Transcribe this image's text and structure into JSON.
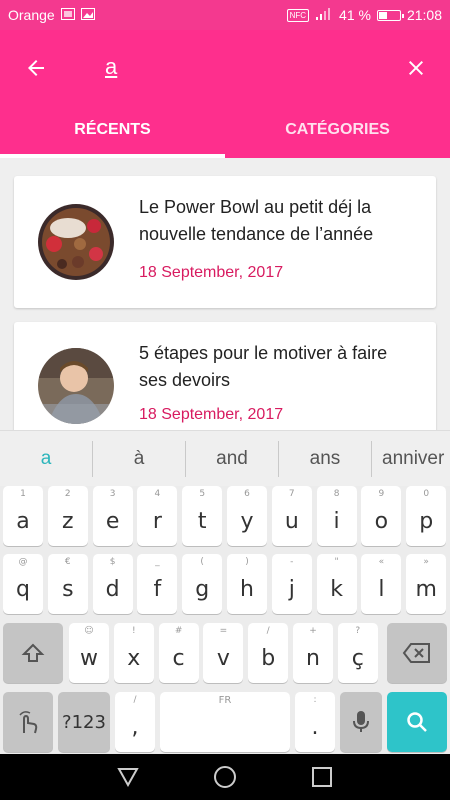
{
  "status_bar": {
    "carrier": "Orange",
    "nfc": "NFC",
    "battery_percent": "41 %",
    "battery_level": 0.41,
    "time": "21:08"
  },
  "app_bar": {
    "back_icon": "arrow-left-icon",
    "search_value": "a",
    "close_icon": "close-icon",
    "tabs": [
      {
        "label": "RÉCENTS",
        "active": true
      },
      {
        "label": "CATÉGORIES",
        "active": false
      }
    ]
  },
  "articles": [
    {
      "title": "Le Power Bowl au petit déj la nouvelle tendance de l’année",
      "date": "18 September, 2017"
    },
    {
      "title": "5 étapes pour le motiver à faire ses devoirs",
      "date": "18 September, 2017"
    }
  ],
  "keyboard": {
    "suggestions": [
      "a",
      "à",
      "and",
      "ans",
      "anniver"
    ],
    "row1": [
      {
        "main": "a",
        "alt": "1"
      },
      {
        "main": "z",
        "alt": "2"
      },
      {
        "main": "e",
        "alt": "3"
      },
      {
        "main": "r",
        "alt": "4"
      },
      {
        "main": "t",
        "alt": "5"
      },
      {
        "main": "y",
        "alt": "6"
      },
      {
        "main": "u",
        "alt": "7"
      },
      {
        "main": "i",
        "alt": "8"
      },
      {
        "main": "o",
        "alt": "9"
      },
      {
        "main": "p",
        "alt": "0"
      }
    ],
    "row2": [
      {
        "main": "q",
        "alt": "@"
      },
      {
        "main": "s",
        "alt": "€"
      },
      {
        "main": "d",
        "alt": "$"
      },
      {
        "main": "f",
        "alt": "_"
      },
      {
        "main": "g",
        "alt": "("
      },
      {
        "main": "h",
        "alt": ")"
      },
      {
        "main": "j",
        "alt": "-"
      },
      {
        "main": "k",
        "alt": "\""
      },
      {
        "main": "l",
        "alt": "«"
      },
      {
        "main": "m",
        "alt": "»"
      }
    ],
    "row3": [
      {
        "main": "w",
        "alt": "☺"
      },
      {
        "main": "x",
        "alt": "!"
      },
      {
        "main": "c",
        "alt": "#"
      },
      {
        "main": "v",
        "alt": "="
      },
      {
        "main": "b",
        "alt": "/"
      },
      {
        "main": "n",
        "alt": "+"
      },
      {
        "main": "ç",
        "alt": "?"
      }
    ],
    "symbols_label": "?123",
    "comma": ",",
    "comma_alt": "/",
    "space_label": "FR",
    "period": ".",
    "period_alt": ":",
    "shift_icon": "shift-icon",
    "backspace_icon": "backspace-icon",
    "gesture_icon": "gesture-icon",
    "mic_icon": "microphone-icon",
    "search_icon": "search-icon",
    "accent_color": "#2ec4c9"
  },
  "nav_bar": {
    "back": "triangle-back-icon",
    "home": "circle-home-icon",
    "recents": "square-recents-icon"
  },
  "colors": {
    "primary": "#fe2f8d",
    "date": "#d81b60"
  }
}
